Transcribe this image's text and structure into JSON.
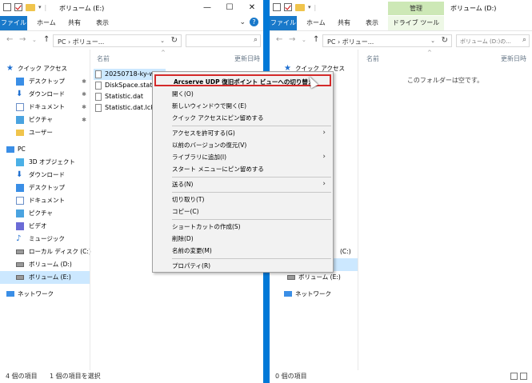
{
  "left": {
    "title": "ボリューム (E:)",
    "tabs": {
      "file": "ファイル",
      "home": "ホーム",
      "share": "共有",
      "view": "表示"
    },
    "address": "PC  ›  ボリュー...",
    "columns": {
      "name": "名前",
      "modified": "更新日時"
    },
    "files": [
      {
        "name": "20250718-ky-wi"
      },
      {
        "name": "DiskSpace.status"
      },
      {
        "name": "Statistic.dat"
      },
      {
        "name": "Statistic.dat.lck"
      }
    ],
    "nav": {
      "quick_access": "クイック アクセス",
      "desktop": "デスクトップ",
      "downloads": "ダウンロード",
      "documents": "ドキュメント",
      "pictures": "ピクチャ",
      "user": "ユーザー",
      "pc": "PC",
      "objects3d": "3D オブジェクト",
      "downloads2": "ダウンロード",
      "desktop2": "デスクトップ",
      "documents2": "ドキュメント",
      "pictures2": "ピクチャ",
      "videos": "ビデオ",
      "music": "ミュージック",
      "local_disk": "ローカル ディスク (C:)",
      "vol_d": "ボリューム (D:)",
      "vol_e": "ボリューム (E:)",
      "network": "ネットワーク"
    },
    "status": {
      "count": "4 個の項目",
      "selected": "1 個の項目を選択"
    }
  },
  "right": {
    "title": "ボリューム (D:)",
    "tabs": {
      "file": "ファイル",
      "home": "ホーム",
      "share": "共有",
      "view": "表示",
      "manage": "管理",
      "drive_tools": "ドライブ ツール"
    },
    "address": "PC  ›  ボリュー...",
    "search_placeholder": "ボリューム (D:)の...",
    "columns": {
      "name": "名前",
      "modified": "更新日時"
    },
    "empty_text": "このフォルダーは空です。",
    "nav": {
      "quick_access": "クイック アクセス",
      "c_suffix": "(C:)",
      "vol_e": "ボリューム (E:)",
      "network": "ネットワーク"
    },
    "status": {
      "count": "0 個の項目"
    }
  },
  "context_menu": {
    "items": [
      "Arcserve UDP 復旧ポイント ビューへの切り替え",
      "開く(O)",
      "新しいウィンドウで開く(E)",
      "クイック アクセスにピン留めする",
      "アクセスを許可する(G)",
      "以前のバージョンの復元(V)",
      "ライブラリに追加(I)",
      "スタート メニューにピン留めする",
      "送る(N)",
      "切り取り(T)",
      "コピー(C)",
      "ショートカットの作成(S)",
      "削除(D)",
      "名前の変更(M)",
      "プロパティ(R)"
    ]
  },
  "colors": {
    "accent": "#0078d7",
    "file_tab": "#1979ca",
    "selection": "#cce8ff",
    "highlight_border": "#d42a2a",
    "manage_tab": "#cde8b6"
  },
  "icons": [
    "check-doc-icon",
    "folder-icon",
    "drive-icon",
    "quick-access-star-icon",
    "desktop-icon",
    "download-icon",
    "documents-icon",
    "pictures-icon",
    "pc-icon",
    "network-icon",
    "submenu-arrow-icon",
    "mouse-cursor-icon"
  ]
}
